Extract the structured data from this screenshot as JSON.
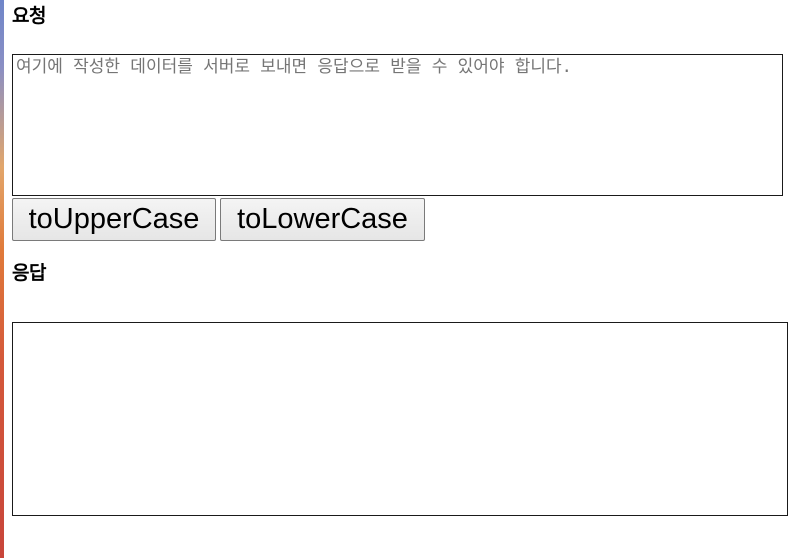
{
  "request": {
    "heading": "요청",
    "placeholder": "여기에 작성한 데이터를 서버로 보내면 응답으로 받을 수 있어야 합니다.",
    "value": ""
  },
  "buttons": {
    "upper_label": "toUpperCase",
    "lower_label": "toLowerCase"
  },
  "response": {
    "heading": "응답",
    "value": ""
  }
}
